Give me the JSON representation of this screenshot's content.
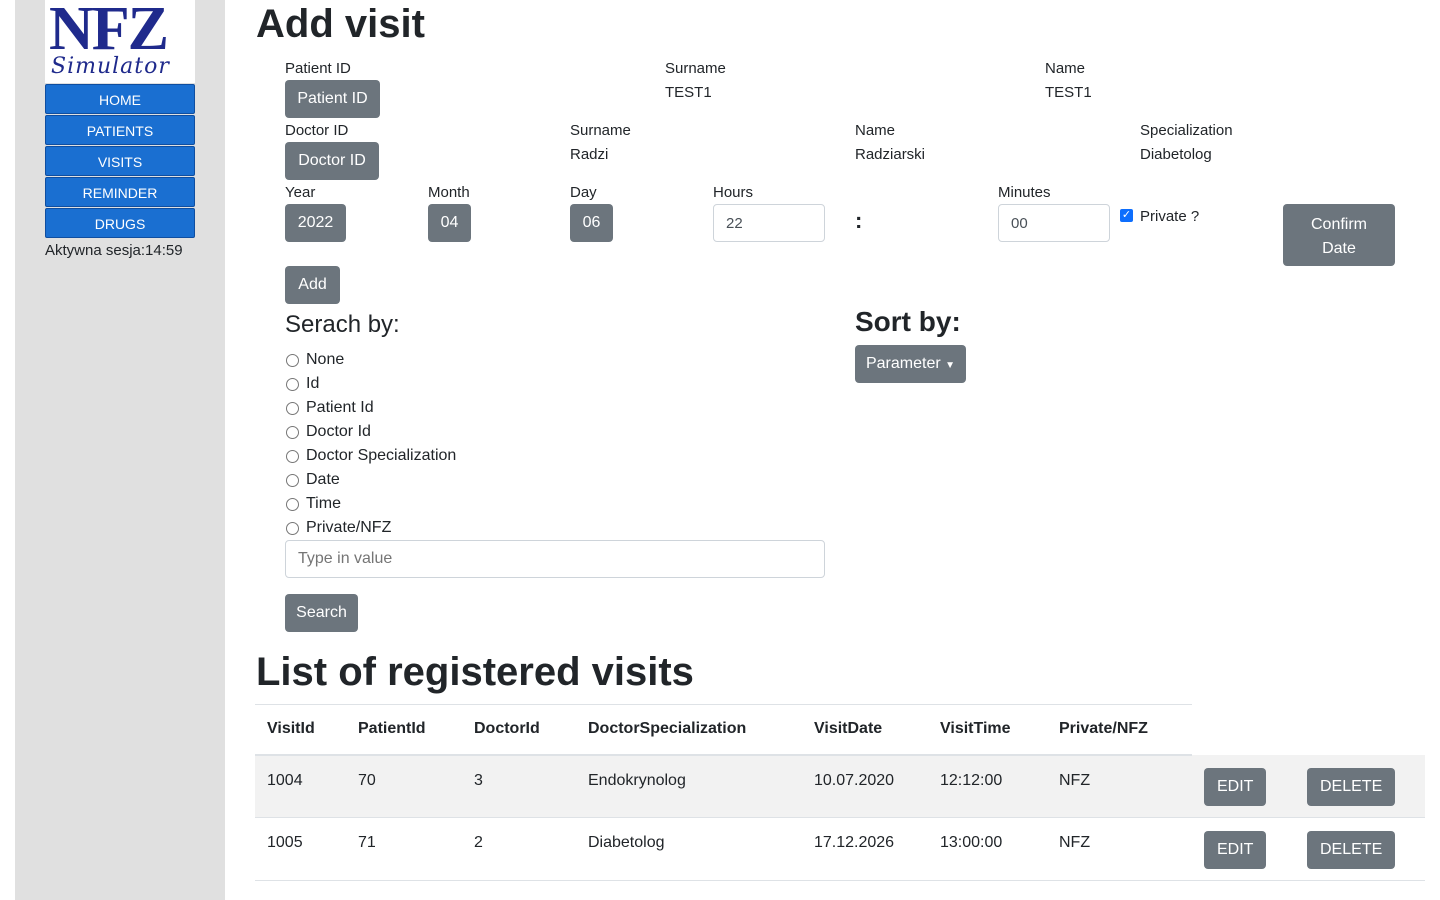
{
  "sidebar": {
    "logo_text": "NFZ",
    "logo_subtext": "Simulator",
    "nav": [
      "HOME",
      "PATIENTS",
      "VISITS",
      "REMINDER",
      "DRUGS"
    ],
    "session_text": "Aktywna sesja:14:59"
  },
  "add_visit": {
    "title": "Add visit",
    "patient_id_label": "Patient ID",
    "patient_id_button": "Patient ID",
    "patient_surname_label": "Surname",
    "patient_surname_value": "TEST1",
    "patient_name_label": "Name",
    "patient_name_value": "TEST1",
    "doctor_id_label": "Doctor ID",
    "doctor_id_button": "Doctor ID",
    "doctor_surname_label": "Surname",
    "doctor_surname_value": "Radzi",
    "doctor_name_label": "Name",
    "doctor_name_value": "Radziarski",
    "specialization_label": "Specialization",
    "specialization_value": "Diabetolog",
    "year_label": "Year",
    "year_value": "2022",
    "month_label": "Month",
    "month_value": "04",
    "day_label": "Day",
    "day_value": "06",
    "hours_label": "Hours",
    "hours_value": "22",
    "colon": ":",
    "minutes_label": "Minutes",
    "minutes_value": "00",
    "private_label": "Private ?",
    "private_checked": true,
    "confirm_line1": "Confirm",
    "confirm_line2": "Date",
    "add_button": "Add"
  },
  "search": {
    "title": "Serach by:",
    "options": [
      "None",
      "Id",
      "Patient Id",
      "Doctor Id",
      "Doctor Specialization",
      "Date",
      "Time",
      "Private/NFZ"
    ],
    "placeholder": "Type in value",
    "button": "Search"
  },
  "sort": {
    "title": "Sort by:",
    "dropdown": "Parameter"
  },
  "visits": {
    "title": "List of registered visits",
    "columns": [
      "VisitId",
      "PatientId",
      "DoctorId",
      "DoctorSpecialization",
      "VisitDate",
      "VisitTime",
      "Private/NFZ"
    ],
    "rows": [
      [
        "1004",
        "70",
        "3",
        "Endokrynolog",
        "10.07.2020",
        "12:12:00",
        "NFZ"
      ],
      [
        "1005",
        "71",
        "2",
        "Diabetolog",
        "17.12.2026",
        "13:00:00",
        "NFZ"
      ]
    ],
    "edit_label": "EDIT",
    "delete_label": "DELETE"
  }
}
